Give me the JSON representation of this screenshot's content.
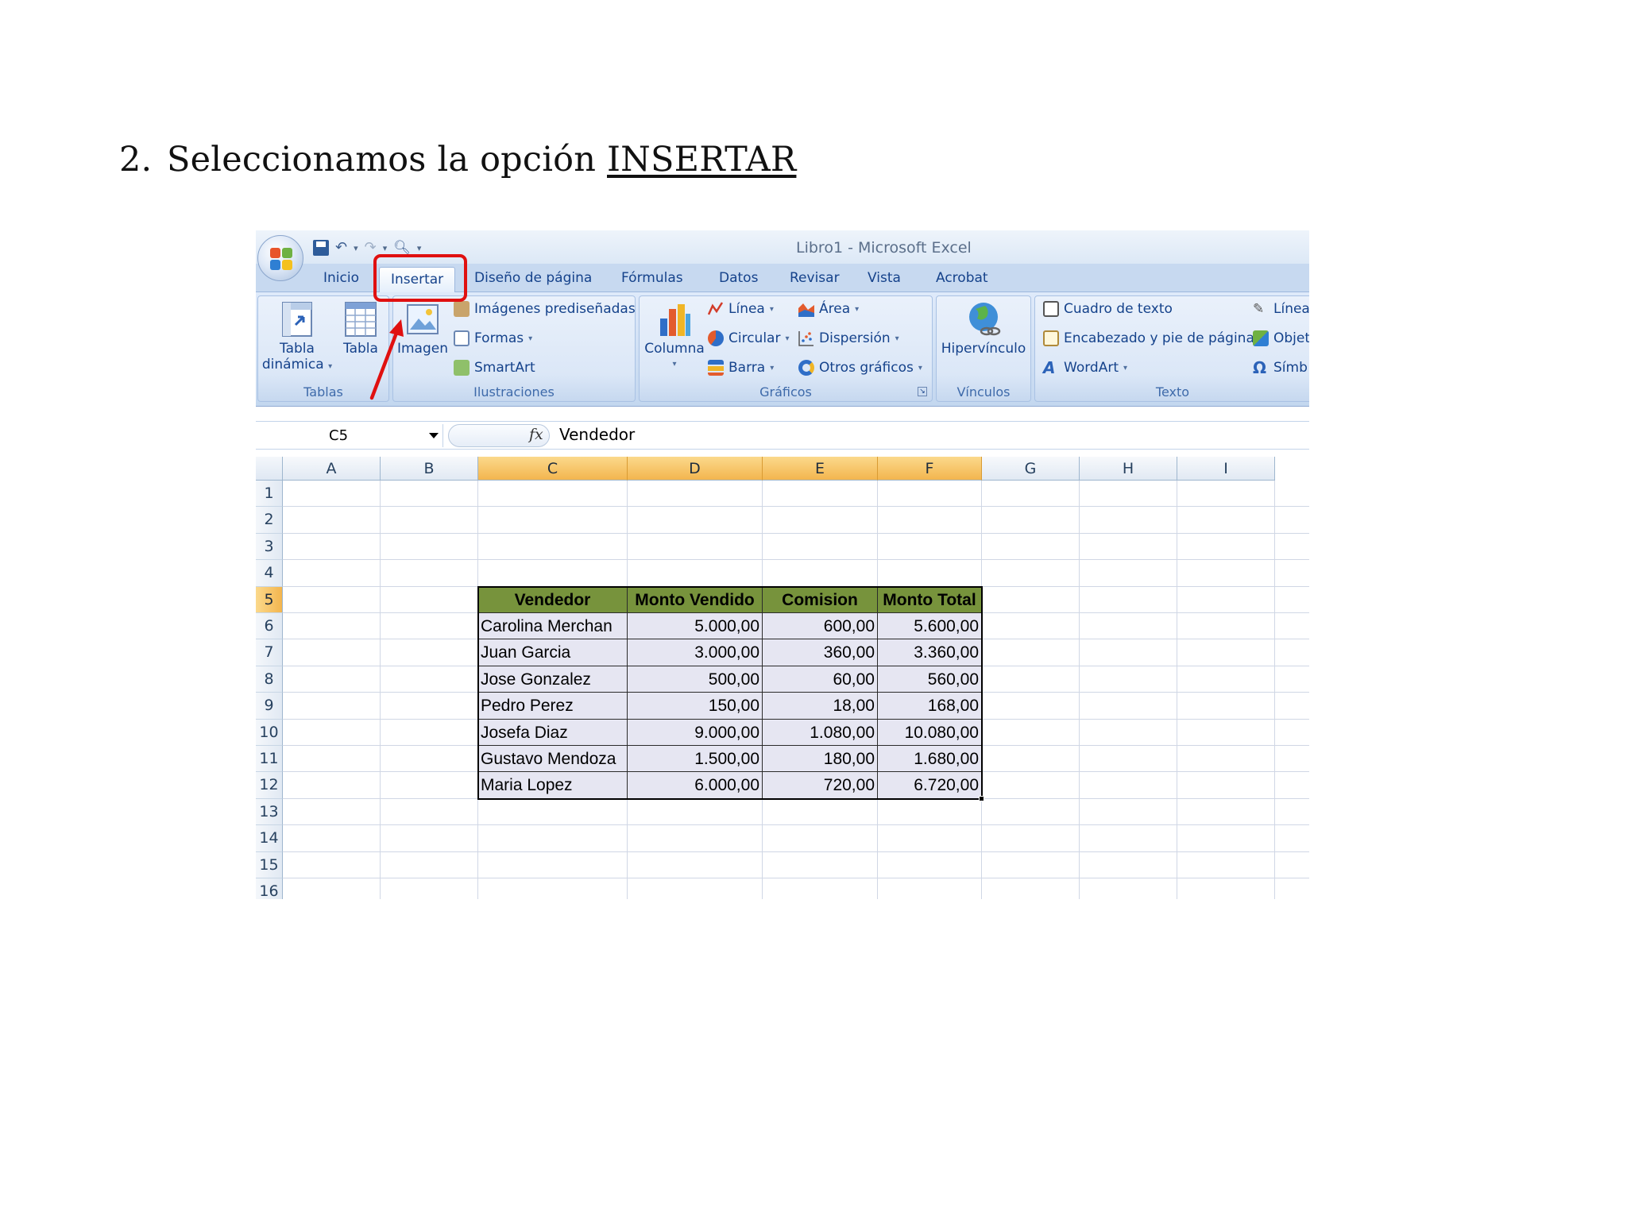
{
  "slide": {
    "step_number": "2.",
    "heading_text": "Seleccionamos la opción ",
    "heading_emphasis": "INSERTAR"
  },
  "window": {
    "title": "Libro1 - Microsoft Excel"
  },
  "tabs": [
    {
      "label": "Inicio",
      "active": false
    },
    {
      "label": "Insertar",
      "active": true
    },
    {
      "label": "Diseño de página",
      "active": false
    },
    {
      "label": "Fórmulas",
      "active": false
    },
    {
      "label": "Datos",
      "active": false
    },
    {
      "label": "Revisar",
      "active": false
    },
    {
      "label": "Vista",
      "active": false
    },
    {
      "label": "Acrobat",
      "active": false
    }
  ],
  "ribbon": {
    "tablas": {
      "label": "Tablas",
      "tabla_dinamica_line1": "Tabla",
      "tabla_dinamica_line2": "dinámica",
      "tabla": "Tabla"
    },
    "ilustraciones": {
      "label": "Ilustraciones",
      "imagen": "Imagen",
      "imagenes_prediseñadas": "Imágenes prediseñadas",
      "formas": "Formas",
      "smartart": "SmartArt"
    },
    "graficos": {
      "label": "Gráficos",
      "columna": "Columna",
      "linea": "Línea",
      "circular": "Circular",
      "barra": "Barra",
      "area": "Área",
      "dispersion": "Dispersión",
      "otros": "Otros gráficos"
    },
    "vinculos": {
      "label": "Vínculos",
      "hipervinculo": "Hipervínculo"
    },
    "texto": {
      "label": "Texto",
      "cuadro_texto": "Cuadro de texto",
      "encabezado": "Encabezado y pie de página",
      "wordart": "WordArt",
      "linea_firma": "Línea",
      "objeto": "Objet",
      "simbolo": "Símb"
    }
  },
  "formula_bar": {
    "name_box": "C5",
    "fx": "fx",
    "content": "Vendedor"
  },
  "grid": {
    "columns": [
      "A",
      "B",
      "C",
      "D",
      "E",
      "F",
      "G",
      "H",
      "I"
    ],
    "rows": [
      "1",
      "2",
      "3",
      "4",
      "5",
      "6",
      "7",
      "8",
      "9",
      "10",
      "11",
      "12",
      "13",
      "14",
      "15",
      "16"
    ],
    "selected_columns": [
      "C",
      "D",
      "E",
      "F"
    ],
    "selected_row": "5"
  },
  "table": {
    "headers": [
      "Vendedor",
      "Monto Vendido",
      "Comision",
      "Monto Total"
    ],
    "rows": [
      [
        "Carolina Merchan",
        "5.000,00",
        "600,00",
        "5.600,00"
      ],
      [
        "Juan Garcia",
        "3.000,00",
        "360,00",
        "3.360,00"
      ],
      [
        "Jose Gonzalez",
        "500,00",
        "60,00",
        "560,00"
      ],
      [
        "Pedro Perez",
        "150,00",
        "18,00",
        "168,00"
      ],
      [
        "Josefa Diaz",
        "9.000,00",
        "1.080,00",
        "10.080,00"
      ],
      [
        "Gustavo Mendoza",
        "1.500,00",
        "180,00",
        "1.680,00"
      ],
      [
        "Maria Lopez",
        "6.000,00",
        "720,00",
        "6.720,00"
      ]
    ],
    "header_color": "#77933c",
    "body_color": "#e6e6f2"
  },
  "colors": {
    "annotation_red": "#e01010",
    "selection_orange": "#f3b54e"
  }
}
